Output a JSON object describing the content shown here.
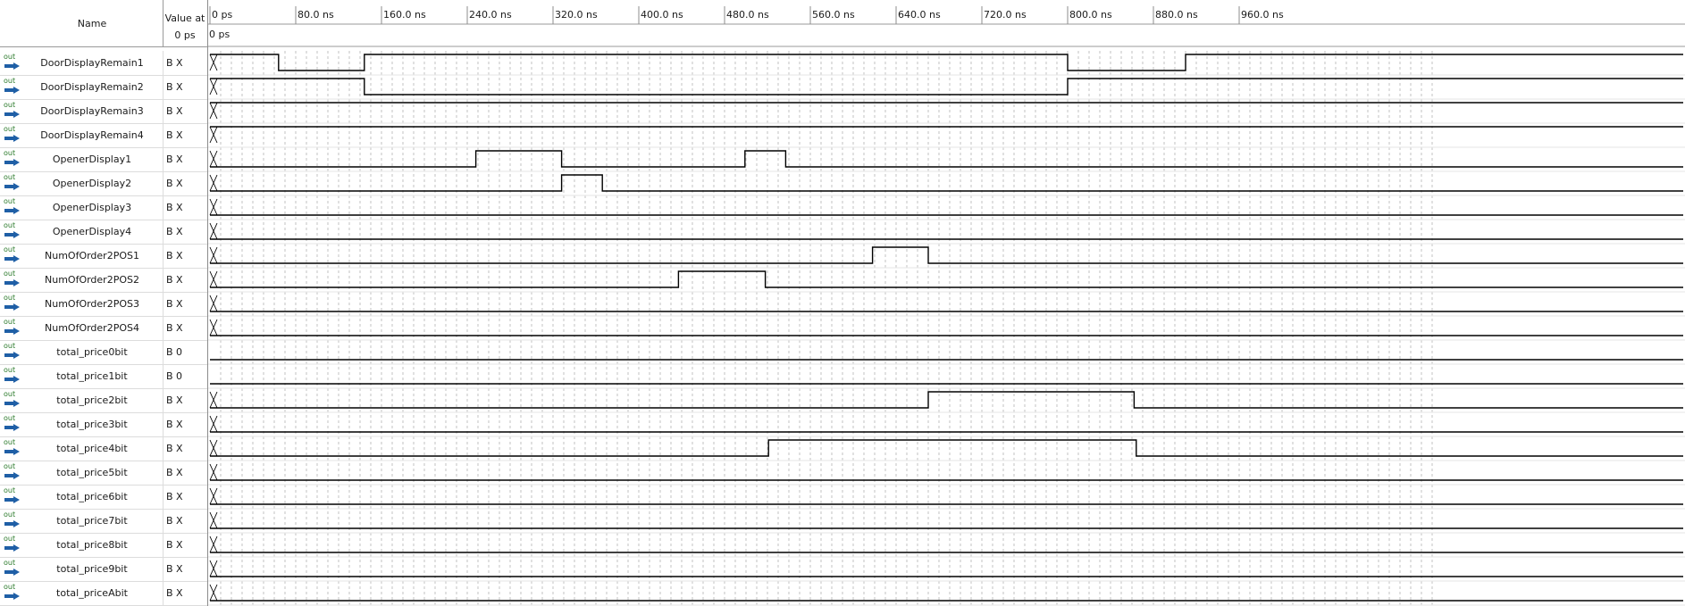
{
  "header": {
    "name_label": "Name",
    "value_label": "Value at",
    "value_time": "0 ps",
    "cursor_label": "0 ps"
  },
  "time_axis": {
    "unit": "ns",
    "ticks": [
      "0 ps",
      "80.0 ns",
      "160.0 ns",
      "240.0 ns",
      "320.0 ns",
      "400.0 ns",
      "480.0 ns",
      "560.0 ns",
      "640.0 ns",
      "720.0 ns",
      "800.0 ns",
      "880.0 ns",
      "960.0 ns"
    ],
    "tick_values_ns": [
      0,
      80,
      160,
      240,
      320,
      400,
      480,
      560,
      640,
      720,
      800,
      880,
      960
    ],
    "visible_range_ns": [
      0,
      1000
    ]
  },
  "signal_icon_text": "out",
  "signals": [
    {
      "name": "DoorDisplayRemain1",
      "value": "B X",
      "initial": 1,
      "edges_ns": [
        64,
        144,
        800,
        910
      ]
    },
    {
      "name": "DoorDisplayRemain2",
      "value": "B X",
      "initial": 1,
      "edges_ns": [
        144,
        800
      ]
    },
    {
      "name": "DoorDisplayRemain3",
      "value": "B X",
      "initial": 1,
      "edges_ns": []
    },
    {
      "name": "DoorDisplayRemain4",
      "value": "B X",
      "initial": 1,
      "edges_ns": []
    },
    {
      "name": "OpenerDisplay1",
      "value": "B X",
      "initial": 0,
      "edges_ns": [
        248,
        328,
        499,
        537
      ]
    },
    {
      "name": "OpenerDisplay2",
      "value": "B X",
      "initial": 0,
      "edges_ns": [
        328,
        366
      ]
    },
    {
      "name": "OpenerDisplay3",
      "value": "B X",
      "initial": 0,
      "edges_ns": []
    },
    {
      "name": "OpenerDisplay4",
      "value": "B X",
      "initial": 0,
      "edges_ns": []
    },
    {
      "name": "NumOfOrder2POS1",
      "value": "B X",
      "initial": 0,
      "edges_ns": [
        618,
        670
      ]
    },
    {
      "name": "NumOfOrder2POS2",
      "value": "B X",
      "initial": 0,
      "edges_ns": [
        437,
        518
      ]
    },
    {
      "name": "NumOfOrder2POS3",
      "value": "B X",
      "initial": 0,
      "edges_ns": []
    },
    {
      "name": "NumOfOrder2POS4",
      "value": "B X",
      "initial": 0,
      "edges_ns": []
    },
    {
      "name": "total_price0bit",
      "value": "B 0",
      "initial": 0,
      "edges_ns": []
    },
    {
      "name": "total_price1bit",
      "value": "B 0",
      "initial": 0,
      "edges_ns": []
    },
    {
      "name": "total_price2bit",
      "value": "B X",
      "initial": 0,
      "edges_ns": [
        670,
        862
      ]
    },
    {
      "name": "total_price3bit",
      "value": "B X",
      "initial": 0,
      "edges_ns": []
    },
    {
      "name": "total_price4bit",
      "value": "B X",
      "initial": 0,
      "edges_ns": [
        521,
        864
      ]
    },
    {
      "name": "total_price5bit",
      "value": "B X",
      "initial": 0,
      "edges_ns": []
    },
    {
      "name": "total_price6bit",
      "value": "B X",
      "initial": 0,
      "edges_ns": []
    },
    {
      "name": "total_price7bit",
      "value": "B X",
      "initial": 0,
      "edges_ns": []
    },
    {
      "name": "total_price8bit",
      "value": "B X",
      "initial": 0,
      "edges_ns": []
    },
    {
      "name": "total_price9bit",
      "value": "B X",
      "initial": 0,
      "edges_ns": []
    },
    {
      "name": "total_priceAbit",
      "value": "B X",
      "initial": 0,
      "edges_ns": []
    }
  ],
  "colors": {
    "wave": "#000000",
    "grid": "#b4b4b4",
    "divider": "#8c8c8c",
    "icon_arrow": "#1f5fa6",
    "icon_text": "#2b7a2b"
  }
}
